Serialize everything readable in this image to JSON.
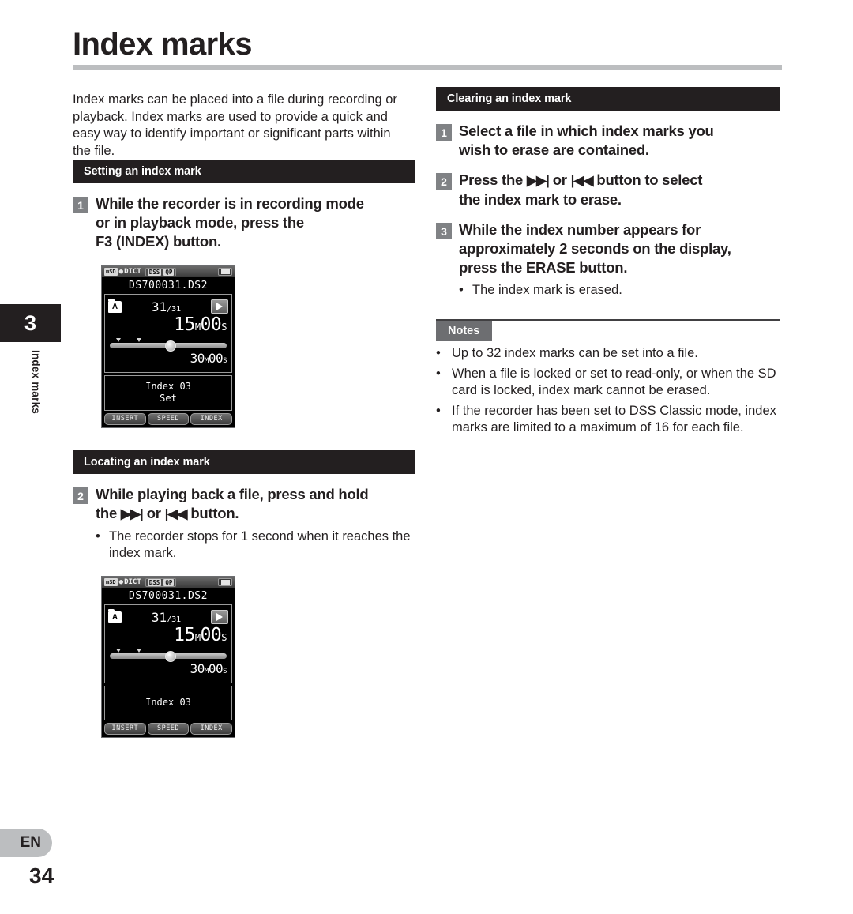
{
  "page": {
    "title": "Index marks",
    "chapter_number": "3",
    "chapter_label": "Index marks",
    "language_code": "EN",
    "page_number": "34"
  },
  "left_column": {
    "intro": "Index marks can be placed into a file during recording or playback. Index marks are used to provide a quick and easy way to identify important or significant parts within the file.",
    "section_setting": {
      "header": "Setting an index mark",
      "step_number": "1",
      "step_line1": "While the recorder is in recording mode",
      "step_line2": "or in playback mode, press the",
      "step_line3": "F3 (INDEX) button."
    },
    "section_locating": {
      "header": "Locating an index mark",
      "step_number": "2",
      "step_line1": "While playing back a file, press and hold",
      "step_prefix": "the",
      "glyph_forward": "▶▶|",
      "step_or": "or",
      "glyph_back": "|◀◀",
      "step_suffix": "button.",
      "bullet": "The recorder stops for 1 second when it reaches the index mark.",
      "bullet_dot": "•"
    }
  },
  "right_column": {
    "section_clearing": {
      "header": "Clearing an index mark",
      "steps": [
        {
          "number": "1",
          "line1": "Select a file in which index marks you",
          "line2": "wish to erase are contained."
        },
        {
          "number": "2",
          "prefix": "Press the",
          "glyph_forward": "▶▶|",
          "or": "or",
          "glyph_back": "|◀◀",
          "suffix": "button to select",
          "line2": "the index mark to erase."
        },
        {
          "number": "3",
          "line1": "While the index number appears for",
          "line2": "approximately 2 seconds on the display,",
          "line3_prefix": "press the",
          "line3_strong": "ERASE",
          "line3_suffix": "button."
        }
      ],
      "bullet_dot": "•",
      "bullet": "The index mark is erased."
    },
    "notes": {
      "badge": "Notes",
      "bullet_dot": "•",
      "items": [
        "Up to 32 index marks can be set into a file.",
        "When a file is locked or set to read-only, or when the SD card is locked, index mark cannot be erased.",
        "If the recorder has been set to DSS Classic mode, index marks are limited to a maximum of 16 for each file."
      ]
    }
  },
  "lcd_setting": {
    "status": {
      "card": "mSD",
      "mic_icon": "🎤",
      "mode": "DICT",
      "format": "DSS",
      "quality": "QP"
    },
    "filename": "DS700031.DS2",
    "folder": "A",
    "current_file": "31",
    "total_files": "/31",
    "play_icon": "play-triangle",
    "time_value": "15",
    "time_unit_m": "M",
    "time_value2": "00",
    "time_unit_s": "S",
    "total_value": "30",
    "total_unit_m": "M",
    "total_value2": "00",
    "total_unit_s": "S",
    "message_line1": "Index 03",
    "message_line2": "Set",
    "fkeys": [
      "INSERT",
      "SPEED",
      "INDEX"
    ]
  },
  "lcd_locating": {
    "status": {
      "card": "mSD",
      "mic_icon": "🎤",
      "mode": "DICT",
      "format": "DSS",
      "quality": "QP"
    },
    "filename": "DS700031.DS2",
    "folder": "A",
    "current_file": "31",
    "total_files": "/31",
    "play_icon": "play-triangle",
    "time_value": "15",
    "time_unit_m": "M",
    "time_value2": "00",
    "time_unit_s": "S",
    "total_value": "30",
    "total_unit_m": "M",
    "total_value2": "00",
    "total_unit_s": "S",
    "message_line1": "Index 03",
    "fkeys": [
      "INSERT",
      "SPEED",
      "INDEX"
    ]
  },
  "colors": {
    "ink": "#231f20",
    "rule_gray": "#bcbec0",
    "step_badge": "#808285",
    "notes_badge": "#6d6e71",
    "section_bar": "#231f20"
  }
}
